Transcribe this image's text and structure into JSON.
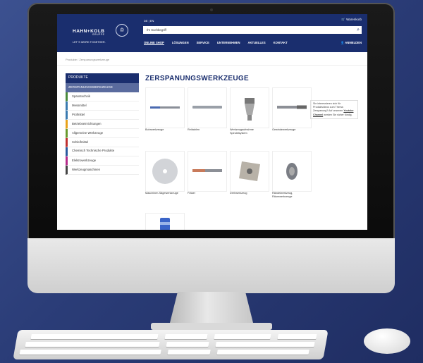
{
  "header": {
    "logo": "HAHN+KOLB",
    "logo_sub": "GRUPPE",
    "tagline": "LET´S WORK TOGETHER.",
    "languages": "DE | EN",
    "cart_label": "Warenkorb",
    "search_placeholder": "Ihr Suchbegriff",
    "nav": [
      "ONLINE SHOP",
      "LÖSUNGEN",
      "SERVICE",
      "UNTERNEHMEN",
      "AKTUELLES",
      "KONTAKT"
    ],
    "login_label": "ANMELDEN"
  },
  "breadcrumb": "Produkte / Zerspanungswerkzeuge",
  "sidebar": {
    "heading": "PRODUKTE",
    "selected": "ZERSPANUNGSWERKZEUGE",
    "items": [
      {
        "label": "Spanntechnik",
        "color": "#4a8b3b"
      },
      {
        "label": "Messmittel",
        "color": "#3a7ab0"
      },
      {
        "label": "Prüfmittel",
        "color": "#3a7ab0"
      },
      {
        "label": "Betriebseinrichtungen",
        "color": "#e8a21a"
      },
      {
        "label": "Allgemeine Werkzeuge",
        "color": "#6a9a2e"
      },
      {
        "label": "Schleifmittel",
        "color": "#c03030"
      },
      {
        "label": "Chemisch Technische Produkte",
        "color": "#2a5a9e"
      },
      {
        "label": "Elektrowerkzeuge",
        "color": "#b52a8a"
      },
      {
        "label": "Werkzeugmaschinen",
        "color": "#444444"
      }
    ]
  },
  "main": {
    "title": "ZERSPANUNGSWERKZEUGE",
    "products": [
      {
        "label": "Bohrwerkzeuge"
      },
      {
        "label": "Reibahlen"
      },
      {
        "label": "Werkzeugaufnahme Spindelsystem"
      },
      {
        "label": "Gewindewerkzeuge"
      },
      {
        "label": "Maschinen-Sägewerkzeuge"
      },
      {
        "label": "Fräser"
      },
      {
        "label": "Drehwerkzeug"
      },
      {
        "label": "Rändelwerkzeug, Räumwerkzeuge"
      },
      {
        "label": ""
      }
    ],
    "info_text_1": "Sie interessieren sich für Produktvideos zum Thema Zerspanung? Auf unserem",
    "info_link": "Youtube Channel",
    "info_text_2": "werden Sie sicher fündig."
  }
}
